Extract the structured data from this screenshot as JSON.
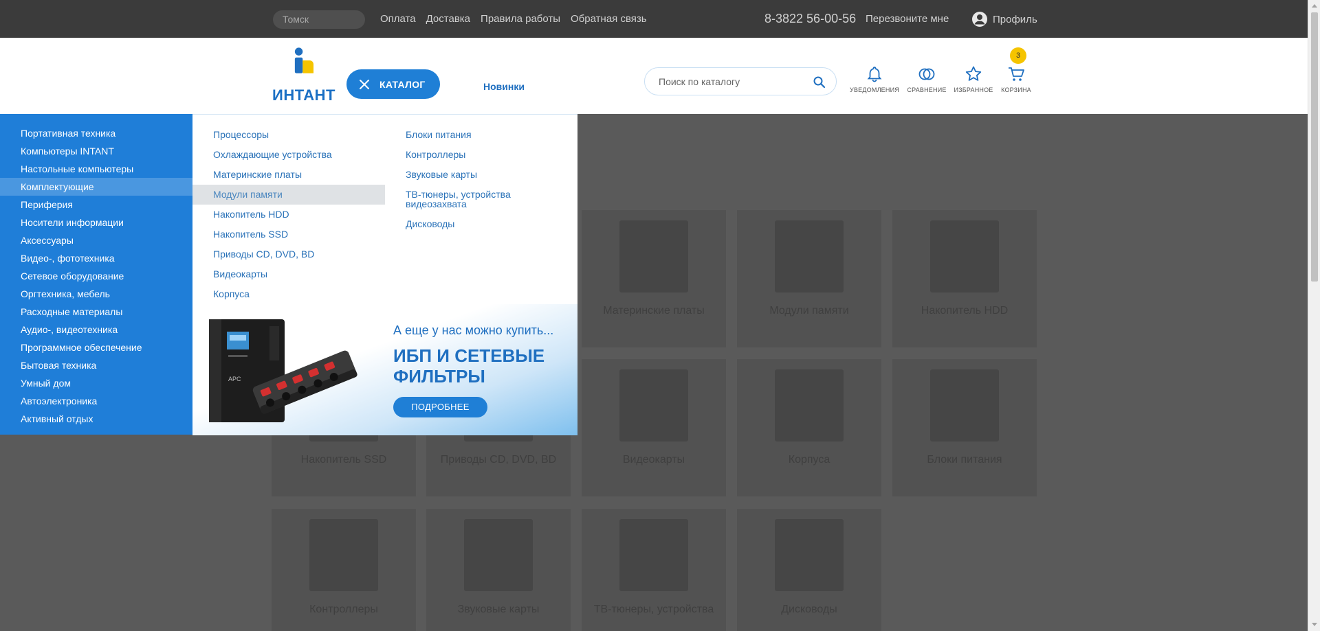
{
  "topbar": {
    "city": "Томск",
    "links": [
      "Оплата",
      "Доставка",
      "Правила работы",
      "Обратная связь"
    ],
    "phone": "8-3822 56-00-56",
    "callback": "Перезвоните мне",
    "profile": "Профиль"
  },
  "header": {
    "logo_text": "ИНТАНТ",
    "catalog_label": "КАТАЛОГ",
    "novelties": "Новинки",
    "search_placeholder": "Поиск по каталогу",
    "icons": {
      "notifications": "УВЕДОМЛЕНИЯ",
      "compare": "СРАВНЕНИЕ",
      "favorites": "ИЗБРАННОЕ",
      "cart": "КОРЗИНА"
    },
    "cart_count": "3",
    "accent_color": "#1f7fd6",
    "badge_color": "#f5c400"
  },
  "menu": {
    "categories": [
      "Портативная техника",
      "Компьютеры INTANT",
      "Настольные компьютеры",
      "Комплектующие",
      "Периферия",
      "Носители информации",
      "Аксессуары",
      "Видео-, фототехника",
      "Сетевое оборудование",
      "Оргтехника, мебель",
      "Расходные материалы",
      "Аудио-, видеотехника",
      "Программное обеспечение",
      "Бытовая техника",
      "Умный дом",
      "Автоэлектроника",
      "Активный отдых"
    ],
    "active_category": "Комплектующие",
    "sub_col1": [
      "Процессоры",
      "Охлаждающие устройства",
      "Материнские платы",
      "Модули памяти",
      "Накопитель HDD",
      "Накопитель SSD",
      "Приводы CD, DVD, BD",
      "Видеокарты",
      "Корпуса"
    ],
    "sub_col2": [
      "Блоки питания",
      "Контроллеры",
      "Звуковые карты",
      "ТВ-тюнеры, устройства видеозахвата",
      "Дисководы"
    ],
    "active_sub": "Модули памяти"
  },
  "banner": {
    "pre": "А еще у нас можно купить...",
    "title": "ИБП И СЕТЕВЫЕ ФИЛЬТРЫ",
    "button": "ПОДРОБНЕЕ",
    "ups_brand": "APC"
  },
  "bg_cards": [
    "Материнские платы",
    "Модули памяти",
    "Накопитель HDD",
    "Накопитель SSD",
    "Приводы CD, DVD, BD",
    "Видеокарты",
    "Корпуса",
    "Блоки питания",
    "Контроллеры",
    "Звуковые карты",
    "ТВ-тюнеры, устройства",
    "Дисководы"
  ]
}
